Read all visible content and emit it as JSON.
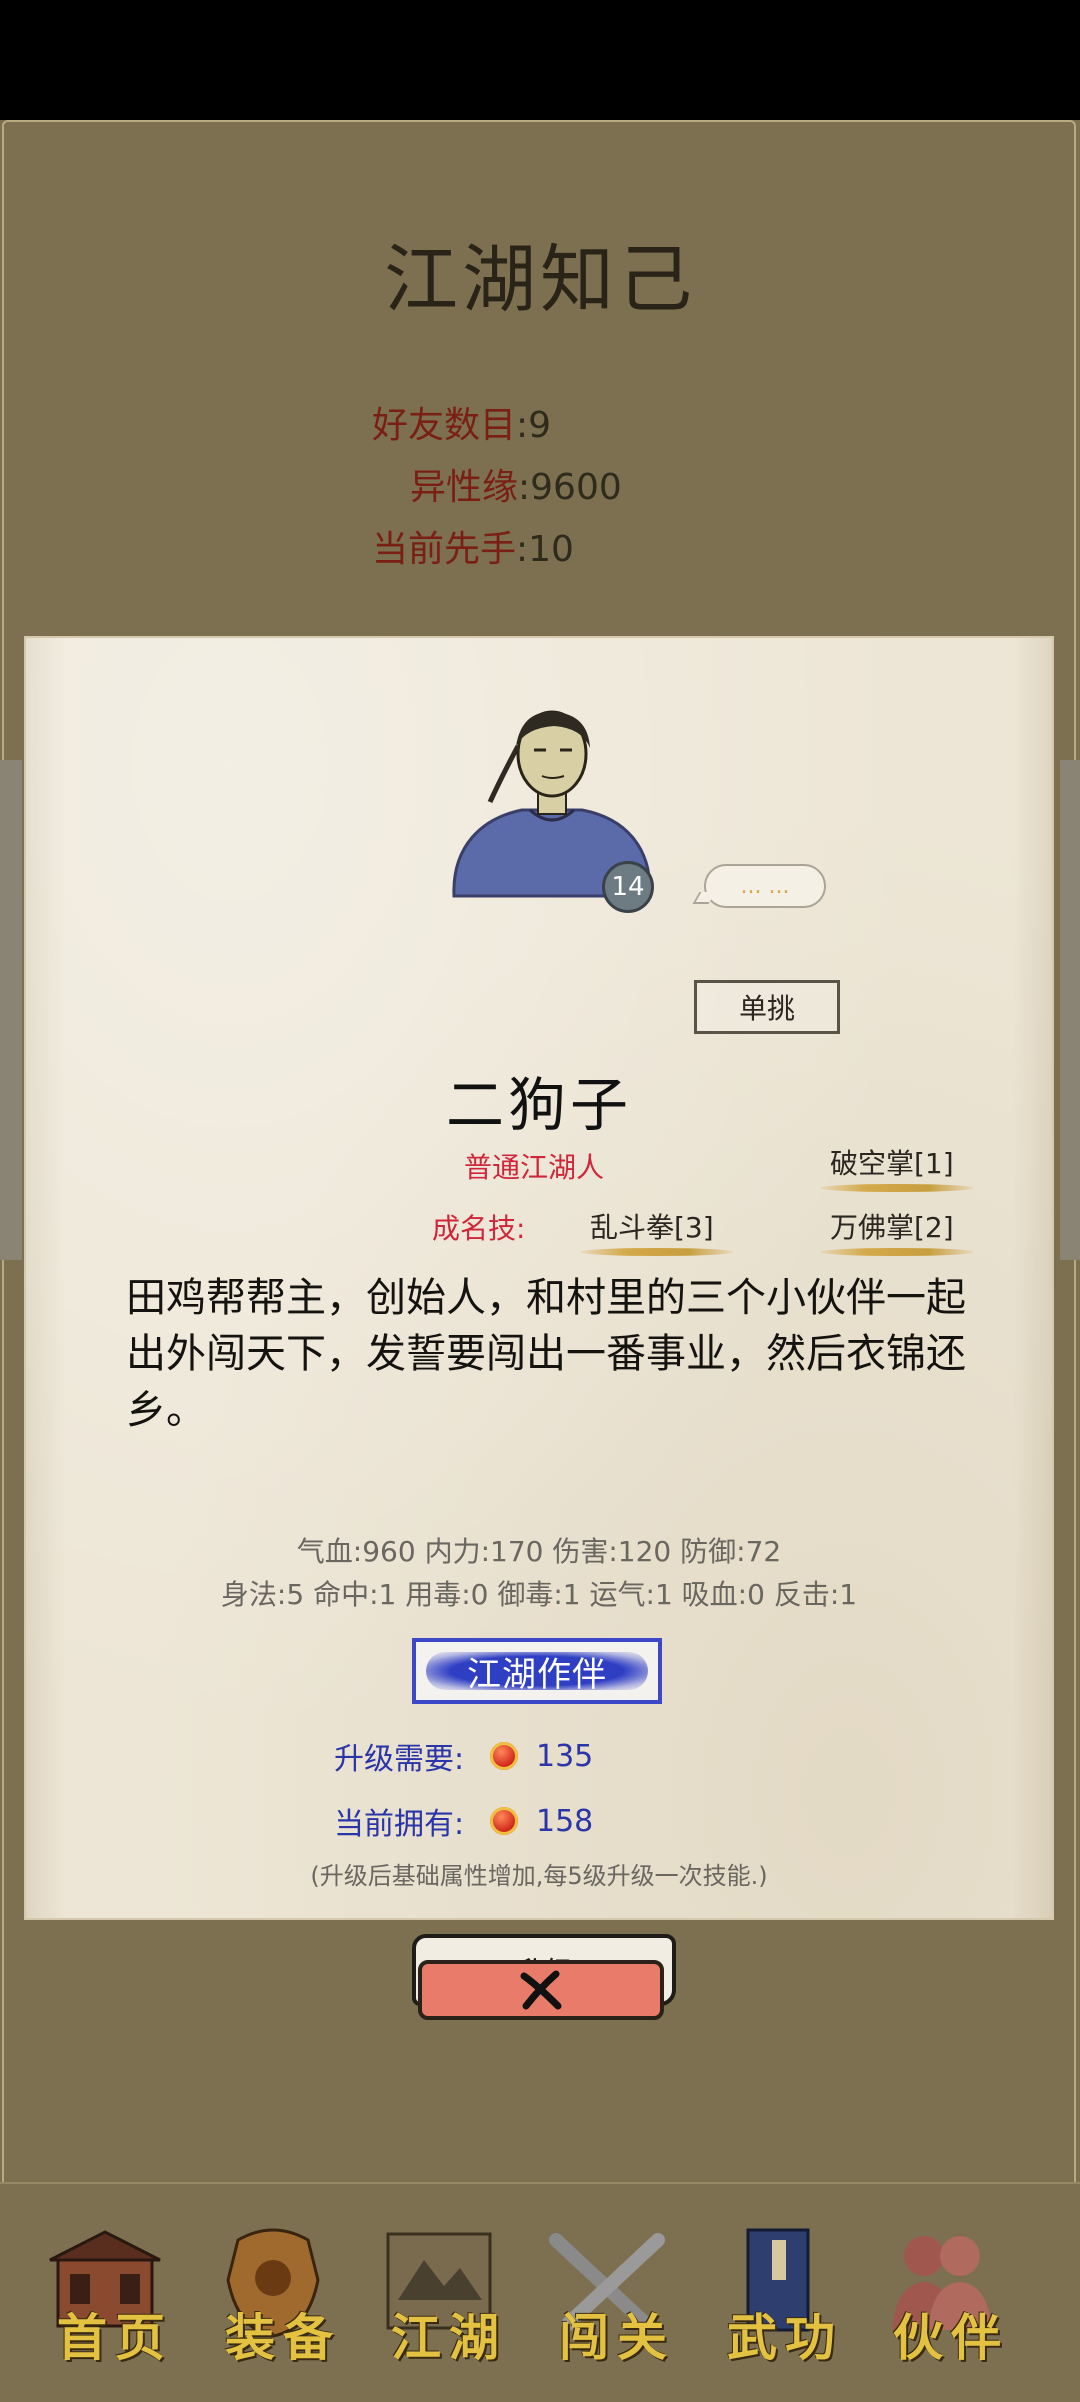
{
  "page": {
    "title": "江湖知己"
  },
  "summary": [
    {
      "label": "好友数目",
      "value": "9"
    },
    {
      "label": "异性缘",
      "value": "9600"
    },
    {
      "label": "当前先手",
      "value": "10"
    }
  ],
  "character": {
    "level": "14",
    "speech": "... ...",
    "duel_label": "单挑",
    "name": "二狗子",
    "rank": "普通江湖人",
    "signature_label": "成名技:",
    "skills": [
      "破空掌[1]",
      "乱斗拳[3]",
      "万佛掌[2]"
    ],
    "bio": "田鸡帮帮主，创始人，和村里的三个小伙伴一起出外闯天下，发誓要闯出一番事业，然后衣锦还乡。",
    "attrs_line1": "气血:960  内力:170  伤害:120  防御:72",
    "attrs_line2": "身法:5  命中:1  用毒:0  御毒:1  运气:1  吸血:0  反击:1"
  },
  "companion_button": "江湖作伴",
  "upgrade": {
    "need_label": "升级需要:",
    "need_value": "135",
    "have_label": "当前拥有:",
    "have_value": "158",
    "note": "(升级后基础属性增加,每5级升级一次技能.)",
    "button": "升级"
  },
  "nav": [
    {
      "label": "首页",
      "icon": "building-icon"
    },
    {
      "label": "装备",
      "icon": "armor-icon"
    },
    {
      "label": "江湖",
      "icon": "scroll-map-icon"
    },
    {
      "label": "闯关",
      "icon": "swords-icon"
    },
    {
      "label": "武功",
      "icon": "book-icon"
    },
    {
      "label": "伙伴",
      "icon": "partners-icon"
    }
  ],
  "colors": {
    "background": "#7d7050",
    "paper": "#ede6d6",
    "accent_red": "#d0263a",
    "accent_blue": "#2f3fc4",
    "nav_text": "#e3c241"
  }
}
